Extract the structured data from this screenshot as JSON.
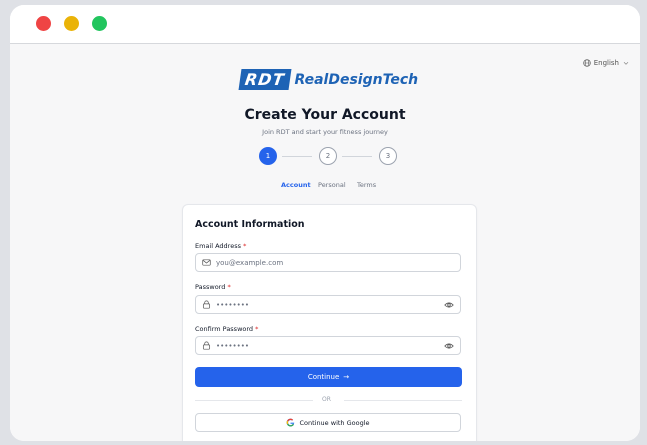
{
  "window": {
    "controls": [
      "close",
      "minimize",
      "maximize"
    ]
  },
  "language": {
    "label": "English",
    "icon": "globe-icon"
  },
  "brand": {
    "mark": "RDT",
    "name": "RealDesignTech",
    "color": "#1e63b5"
  },
  "header": {
    "title": "Create Your Account",
    "subtitle": "Join RDT and start your fitness journey"
  },
  "steps": [
    {
      "number": "1",
      "label": "Account",
      "active": true
    },
    {
      "number": "2",
      "label": "Personal",
      "active": false
    },
    {
      "number": "3",
      "label": "Terms",
      "active": false
    }
  ],
  "form": {
    "title": "Account Information",
    "email": {
      "label": "Email Address",
      "required": "*",
      "placeholder": "you@example.com"
    },
    "password": {
      "label": "Password",
      "required": "*",
      "value": "••••••••"
    },
    "confirm": {
      "label": "Confirm Password",
      "required": "*",
      "value": "••••••••"
    },
    "continue_label": "Continue",
    "divider": "OR",
    "google_label": "Continue with Google"
  },
  "colors": {
    "primary": "#2563eb",
    "required": "#dc2626",
    "accent_yellow": "#facc15"
  }
}
